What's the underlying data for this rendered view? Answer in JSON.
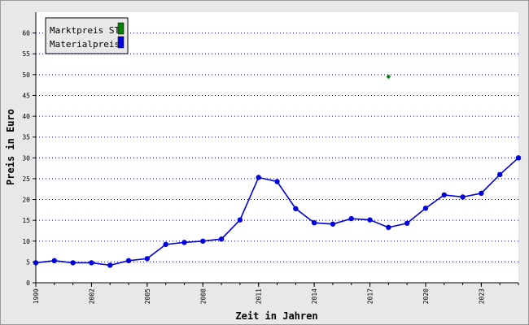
{
  "chart_data": {
    "type": "line",
    "xlabel": "Zeit in Jahren",
    "ylabel": "Preis in Euro",
    "xlim": [
      1999,
      2025
    ],
    "ylim": [
      0,
      65
    ],
    "x_ticks": [
      1999,
      2002,
      2005,
      2008,
      2011,
      2014,
      2017,
      2020,
      2023
    ],
    "y_ticks": [
      0,
      5,
      10,
      15,
      20,
      25,
      30,
      35,
      40,
      45,
      50,
      55,
      60
    ],
    "grid": "horizontal dotted",
    "legend_position": "top-left",
    "series": [
      {
        "name": "Marktpreis ST",
        "color": "#008000",
        "marker": "diamond",
        "line": false,
        "x": [
          2018
        ],
        "y": [
          49.5
        ]
      },
      {
        "name": "Materialpreis",
        "color": "#0000dd",
        "marker": "circle",
        "line": true,
        "x": [
          1999,
          2000,
          2001,
          2002,
          2003,
          2004,
          2005,
          2006,
          2007,
          2008,
          2009,
          2010,
          2011,
          2012,
          2013,
          2014,
          2015,
          2016,
          2017,
          2018,
          2019,
          2020,
          2021,
          2022,
          2023,
          2024,
          2025
        ],
        "y": [
          4.8,
          5.3,
          4.8,
          4.8,
          4.2,
          5.3,
          5.8,
          9.2,
          9.7,
          10.0,
          10.5,
          15.1,
          25.3,
          24.3,
          17.8,
          14.4,
          14.1,
          15.4,
          15.1,
          13.3,
          14.3,
          17.9,
          21.1,
          20.6,
          21.5,
          26.0,
          30.0
        ]
      }
    ]
  }
}
